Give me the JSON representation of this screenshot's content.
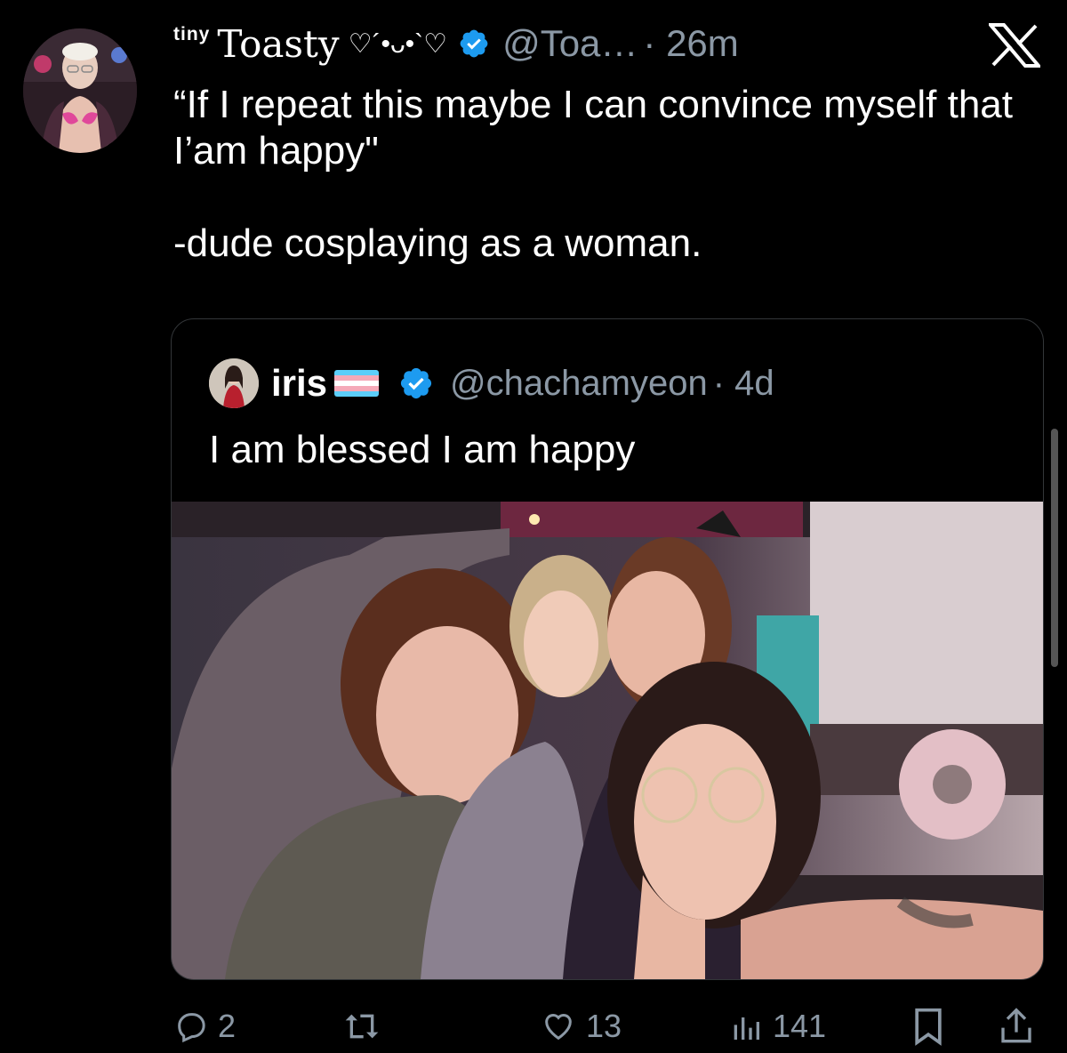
{
  "author": {
    "name_small": "tiny",
    "name_big": "Toasty",
    "name_decoration": "♡´•ᴗ•`♡",
    "handle": "@Toa…",
    "time": "· 26m"
  },
  "tweet": {
    "text": "“If I repeat this maybe I can convince myself that I’am happy\"\n\n-dude cosplaying as a woman."
  },
  "quote": {
    "name": "iris",
    "handle": "@chachamyeon",
    "time": "· 4d",
    "text": "I am blessed I am happy"
  },
  "actions": {
    "replies": "2",
    "likes": "13",
    "views": "141"
  },
  "colors": {
    "background": "#000000",
    "verified": "#1d9bf0",
    "muted": "#8b98a5",
    "text": "#ffffff"
  },
  "icons": [
    "x-logo-icon",
    "verified-badge-icon",
    "reply-icon",
    "retweet-icon",
    "like-icon",
    "views-icon",
    "bookmark-icon",
    "share-icon"
  ]
}
